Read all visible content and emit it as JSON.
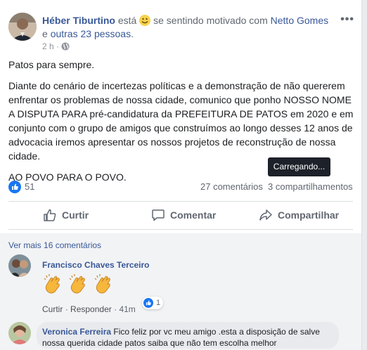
{
  "post": {
    "author": "Héber Tiburtino",
    "header_word": "está",
    "feeling": "se sentindo motivado com",
    "tagged": "Netto Gomes",
    "header_and": "e",
    "others": "outras 23 pessoas",
    "header_end": ".",
    "time": "2 h ·",
    "menu": "•••",
    "paragraphs": [
      "Patos para sempre.",
      "Diante do cenário de incertezas políticas e a demonstração de não quererem enfrentar os problemas de nossa cidade, comunico que ponho NOSSO NOME A DISPUTA PARA pré-candidatura da PREFEITURA DE PATOS em 2020 e em conjunto com o grupo de amigos que construímos ao longo desses 12 anos de advocacia iremos apresentar os nossos projetos de reconstrução de nossa cidade.",
      "AO POVO PARA O POVO."
    ],
    "tooltip": "Carregando..."
  },
  "stats": {
    "reactions": "51",
    "comments": "27 comentários",
    "shares": "3 compartilhamentos"
  },
  "actions": {
    "like": "Curtir",
    "comment": "Comentar",
    "share": "Compartilhar"
  },
  "comments": {
    "more": "Ver mais 16 comentários",
    "c1": {
      "name": "Francisco Chaves Terceiro",
      "like": "Curtir",
      "sep": "·",
      "reply": "Responder",
      "time": "41m",
      "reactions": "1"
    },
    "c2": {
      "name": "Veronica Ferreira",
      "text": "Fico feliz por vc meu amigo .esta a disposição de salve nossa querida cidade patos saiba que não tem escolha melhor"
    }
  },
  "colors": {
    "link": "#385898",
    "accent": "#1877f2"
  }
}
